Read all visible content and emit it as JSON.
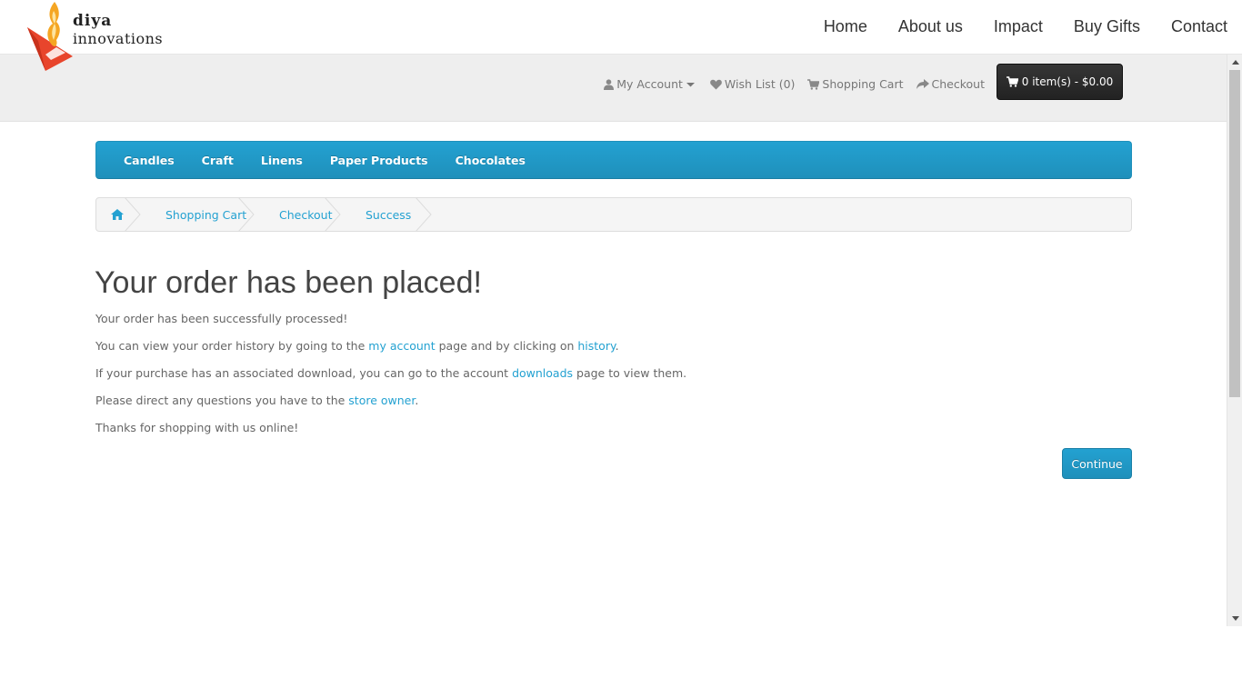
{
  "logo": {
    "line1": "diya",
    "line2": "innovations"
  },
  "main_nav": [
    "Home",
    "About us",
    "Impact",
    "Buy Gifts",
    "Contact"
  ],
  "topbar": {
    "my_account": "My Account",
    "wish_list": "Wish List (0)",
    "shopping_cart": "Shopping Cart",
    "checkout": "Checkout",
    "cart_summary": "0 item(s) - $0.00"
  },
  "categories": [
    "Candles",
    "Craft",
    "Linens",
    "Paper Products",
    "Chocolates"
  ],
  "breadcrumb": {
    "shopping_cart": "Shopping Cart",
    "checkout": "Checkout",
    "success": "Success"
  },
  "content": {
    "title": "Your order has been placed!",
    "p1": "Your order has been successfully processed!",
    "p2_a": "You can view your order history by going to the ",
    "p2_link1": "my account",
    "p2_b": " page and by clicking on ",
    "p2_link2": "history",
    "p2_c": ".",
    "p3_a": "If your purchase has an associated download, you can go to the account ",
    "p3_link": "downloads",
    "p3_b": " page to view them.",
    "p4_a": "Please direct any questions you have to the ",
    "p4_link": "store owner",
    "p4_b": ".",
    "p5": "Thanks for shopping with us online!",
    "continue": "Continue"
  },
  "colors": {
    "accent": "#23a1d1",
    "cart_button": "#2a2a2a",
    "logo_orange": "#f26522"
  },
  "icons": [
    "user-icon",
    "heart-icon",
    "cart-icon",
    "share-icon",
    "home-icon",
    "caret-down-icon",
    "flame-logo-icon"
  ]
}
